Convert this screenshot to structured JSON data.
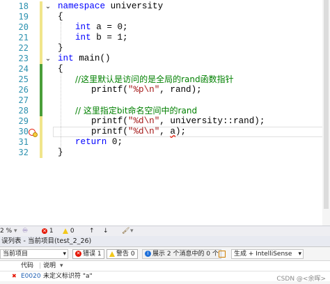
{
  "editor": {
    "line_numbers": [
      "18",
      "19",
      "20",
      "21",
      "22",
      "23",
      "24",
      "25",
      "26",
      "27",
      "28",
      "29",
      "30",
      "31",
      "32"
    ],
    "lines": {
      "l18": {
        "kw": "namespace",
        "rest": " university"
      },
      "l19": {
        "brace": "{"
      },
      "l20": {
        "kw": "int",
        "rest": " a = 0;"
      },
      "l21": {
        "kw": "int",
        "rest": " b = 1;"
      },
      "l22": {
        "brace": "}"
      },
      "l23": {
        "kw": "int",
        "rest": " main()"
      },
      "l24": {
        "brace": "{"
      },
      "l25": {
        "comment": "//这里默认是访问的是全局的rand函数指针"
      },
      "l26": {
        "fn": "printf(",
        "str": "\"%p\\n\"",
        "rest": ", rand);"
      },
      "l28": {
        "comment": "// 这里指定bit命名空间中的rand"
      },
      "l29": {
        "fn": "printf(",
        "str": "\"%d\\n\"",
        "rest": ", university::rand);"
      },
      "l30": {
        "fn": "printf(",
        "str": "\"%d\\n\"",
        "mid": ", ",
        "err": "a",
        "rest": ");"
      },
      "l31": {
        "kw": "return",
        "rest": " 0;"
      },
      "l32": {
        "brace": "}"
      }
    },
    "fold_glyph": "⌄"
  },
  "statusbar": {
    "zoom": "2 %",
    "errors": "1",
    "warnings": "0",
    "up_arrow": "↑",
    "down_arrow": "↓"
  },
  "error_list": {
    "title": "误列表 - 当前项目(test_2_26)",
    "scope": "当前项目",
    "errors_button": "错误 1",
    "warnings_button": "警告 0",
    "messages_button": "展示 2 个消息中的 0 个",
    "source": "生成 + IntelliSense",
    "col_code": "代码",
    "col_desc": "说明",
    "row": {
      "code": "E0020",
      "description": "未定义标识符 \"a\""
    }
  },
  "watermark": "CSDN @<余晖>",
  "colors": {
    "keyword": "#0000ff",
    "string": "#a31515",
    "comment": "#008000",
    "line_number": "#2b91af",
    "error": "#e51400"
  }
}
